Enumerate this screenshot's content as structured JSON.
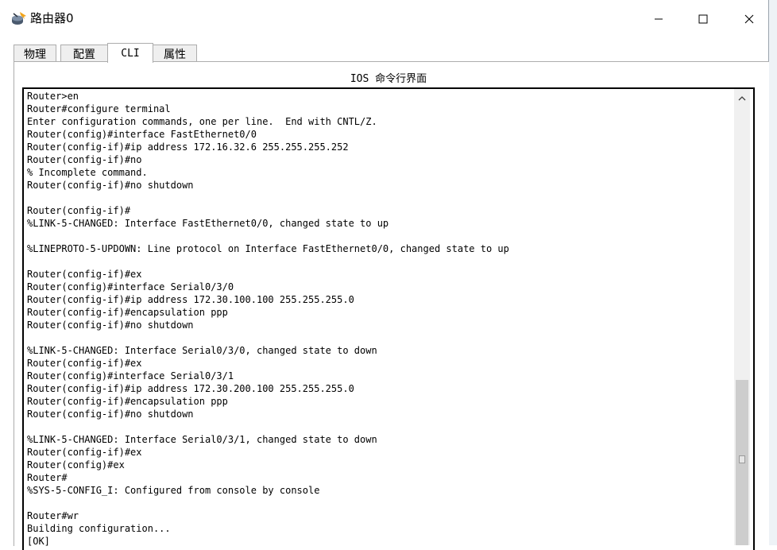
{
  "window": {
    "title": "路由器0",
    "icon": "router-icon",
    "controls": {
      "minimize": "minimize-icon",
      "maximize": "maximize-icon",
      "close": "close-icon"
    }
  },
  "tabs": [
    {
      "label": "物理",
      "active": false
    },
    {
      "label": "配置",
      "active": false
    },
    {
      "label": "CLI",
      "active": true
    },
    {
      "label": "属性",
      "active": false
    }
  ],
  "cli": {
    "heading": "IOS 命令行界面",
    "lines": [
      "Router>en",
      "Router#configure terminal",
      "Enter configuration commands, one per line.  End with CNTL/Z.",
      "Router(config)#interface FastEthernet0/0",
      "Router(config-if)#ip address 172.16.32.6 255.255.255.252",
      "Router(config-if)#no",
      "% Incomplete command.",
      "Router(config-if)#no shutdown",
      "",
      "Router(config-if)#",
      "%LINK-5-CHANGED: Interface FastEthernet0/0, changed state to up",
      "",
      "%LINEPROTO-5-UPDOWN: Line protocol on Interface FastEthernet0/0, changed state to up",
      "",
      "Router(config-if)#ex",
      "Router(config)#interface Serial0/3/0",
      "Router(config-if)#ip address 172.30.100.100 255.255.255.0",
      "Router(config-if)#encapsulation ppp",
      "Router(config-if)#no shutdown",
      "",
      "%LINK-5-CHANGED: Interface Serial0/3/0, changed state to down",
      "Router(config-if)#ex",
      "Router(config)#interface Serial0/3/1",
      "Router(config-if)#ip address 172.30.200.100 255.255.255.0",
      "Router(config-if)#encapsulation ppp",
      "Router(config-if)#no shutdown",
      "",
      "%LINK-5-CHANGED: Interface Serial0/3/1, changed state to down",
      "Router(config-if)#ex",
      "Router(config)#ex",
      "Router#",
      "%SYS-5-CONFIG_I: Configured from console by console",
      "",
      "Router#wr",
      "Building configuration...",
      "[OK]"
    ]
  }
}
